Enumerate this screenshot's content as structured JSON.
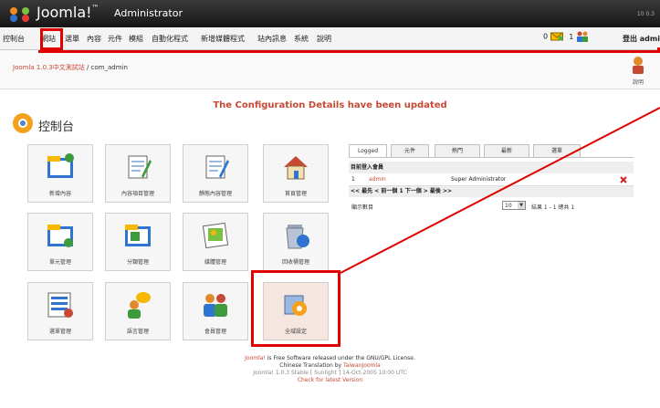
{
  "header": {
    "brand": "Joomla!",
    "trademark": "™",
    "subtitle": "Administrator",
    "version": "10 0.3"
  },
  "menu": {
    "items": [
      "控制台",
      "網站",
      "選單",
      "內容",
      "元件",
      "模組",
      "自動化程式",
      "新增媒體程式",
      "站內訊息",
      "系統",
      "說明"
    ],
    "messages_count": "0",
    "users_count": "1",
    "logout_label": "登出 admin"
  },
  "breadcrumb": {
    "site": "Joomla 1.0.3中文測試站",
    "path": "/ com_admin"
  },
  "toolbar": {
    "help_label": "說明"
  },
  "message": "The Configuration Details have been updated",
  "page_title": "控制台",
  "tiles": [
    {
      "label": "新增內容",
      "icon": "add-content-icon"
    },
    {
      "label": "內容項目管理",
      "icon": "content-items-icon"
    },
    {
      "label": "靜態內容管理",
      "icon": "static-content-icon"
    },
    {
      "label": "首頁管理",
      "icon": "frontpage-icon"
    },
    {
      "label": "單元管理",
      "icon": "section-icon"
    },
    {
      "label": "分類管理",
      "icon": "category-icon"
    },
    {
      "label": "媒體管理",
      "icon": "media-icon"
    },
    {
      "label": "回收桶管理",
      "icon": "trash-icon"
    },
    {
      "label": "選單管理",
      "icon": "menu-manager-icon"
    },
    {
      "label": "語言管理",
      "icon": "language-icon"
    },
    {
      "label": "會員管理",
      "icon": "users-icon"
    },
    {
      "label": "全域設定",
      "icon": "global-config-icon"
    }
  ],
  "panel": {
    "tabs": [
      "Logged",
      "元件",
      "熱門",
      "最新",
      "選單"
    ],
    "heading": "目前登入會員",
    "rows": [
      {
        "num": "1",
        "user": "admin",
        "group": "Super Administrator"
      }
    ],
    "pager": "<< 最先 < 前一個 1 下一個 > 最後 >>",
    "display_label": "顯示數目",
    "display_value": "10",
    "results": "結果 1 - 1 總共 1"
  },
  "footer": {
    "line1_link": "Joomla!",
    "line1": " is Free Software released under the GNU/GPL License.",
    "line2": "Chinese Translation by ",
    "line2_link": "TaiwanJoomla",
    "line3": "Joomla! 1.0.3 Stable [ Sunlight ] 14-Oct-2005 10:00 UTC",
    "line4": "Check for latest Version"
  },
  "colors": {
    "accent": "#c64934",
    "annotation": "#e00000",
    "topbar": "#1e1e1e"
  }
}
